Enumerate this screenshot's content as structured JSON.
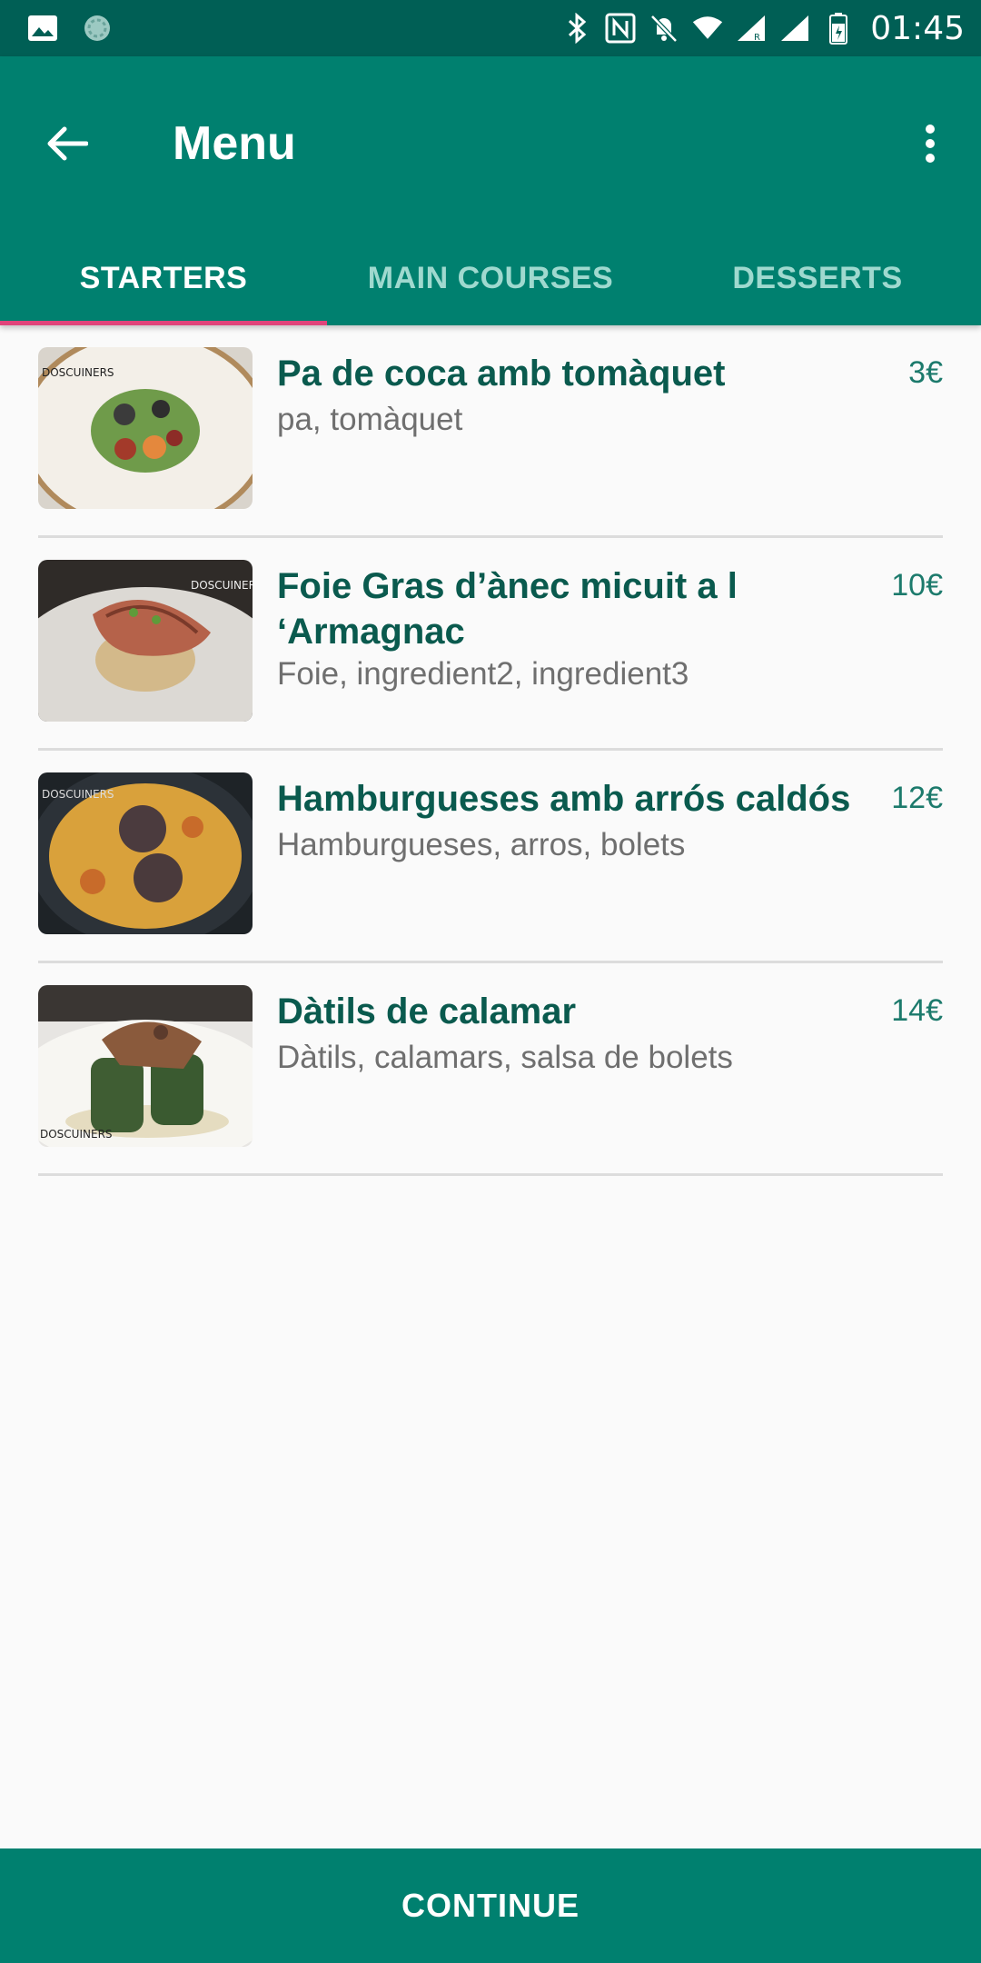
{
  "status_bar": {
    "time": "01:45",
    "left_icons": [
      "image-icon",
      "sync-icon"
    ],
    "right_icons": [
      "bluetooth-icon",
      "nfc-icon",
      "notifications-off-icon",
      "wifi-icon",
      "signal-icon",
      "signal-icon",
      "battery-icon"
    ]
  },
  "toolbar": {
    "title": "Menu",
    "back_icon": "arrow-back-icon",
    "overflow_icon": "more-vert-icon"
  },
  "tabs": [
    {
      "label": "STARTERS",
      "active": true
    },
    {
      "label": "MAIN COURSES",
      "active": false
    },
    {
      "label": "DESSERTS",
      "active": false
    }
  ],
  "items": [
    {
      "name": "Pa de coca amb tomàquet",
      "ingredients": "pa, tomàquet",
      "price": "3€"
    },
    {
      "name": "Foie Gras d’ànec micuit a l ‘Armagnac",
      "ingredients": "Foie, ingredient2, ingredient3",
      "price": "10€"
    },
    {
      "name": "Hamburgueses amb arrós caldós",
      "ingredients": "Hamburgueses, arros, bolets",
      "price": "12€"
    },
    {
      "name": "Dàtils de calamar",
      "ingredients": "Dàtils, calamars, salsa de bolets",
      "price": "14€"
    }
  ],
  "continue_label": "CONTINUE",
  "colors": {
    "status_bar": "#005f55",
    "primary": "#00806f",
    "tab_indicator": "#e0457b",
    "item_title": "#0a5a4e",
    "price": "#1c7a6c"
  }
}
